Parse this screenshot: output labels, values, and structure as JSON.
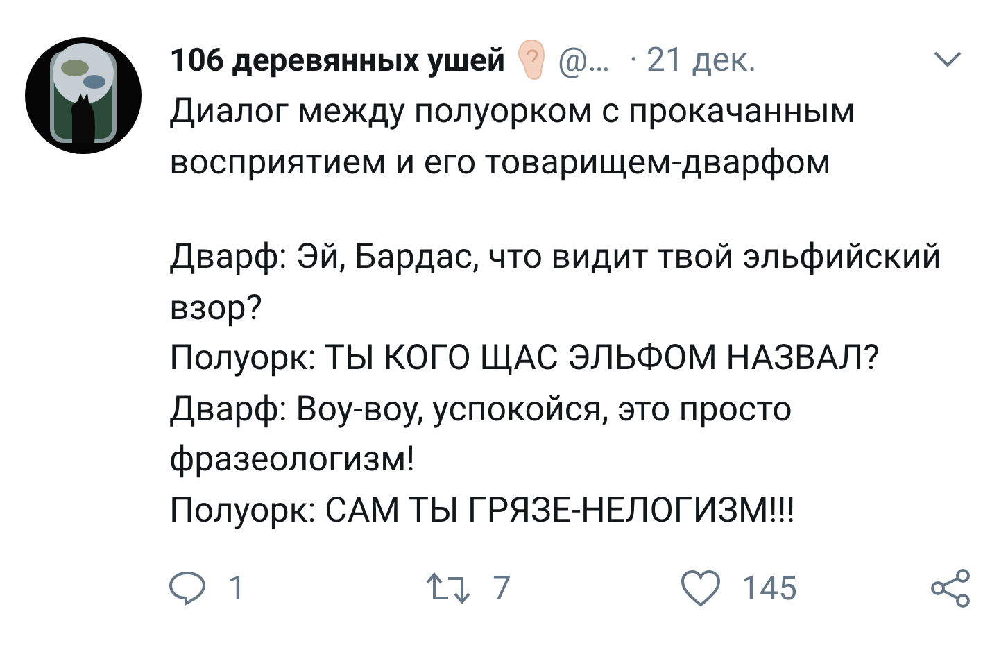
{
  "tweet": {
    "author": {
      "name": "106 деревянных ушей",
      "handle": "@…",
      "date": "· 21 дек."
    },
    "paragraphs": [
      {
        "lines": [
          "Диалог между полуорком с прокачанным восприятием и его товарищем-дварфом"
        ]
      },
      {
        "lines": [
          "Дварф: Эй, Бардас, что видит твой эльфийский взор?",
          "Полуорк: ТЫ КОГО ЩАС ЭЛЬФОМ НАЗВАЛ?",
          "Дварф: Воу-воу, успокойся, это просто фразеологизм!",
          "Полуорк: САМ ТЫ ГРЯЗЕ-НЕЛОГИЗМ!!!"
        ]
      }
    ],
    "actions": [
      {
        "kind": "reply",
        "count": "1"
      },
      {
        "kind": "retweet",
        "count": "7"
      },
      {
        "kind": "like",
        "count": "145"
      },
      {
        "kind": "share"
      }
    ]
  }
}
